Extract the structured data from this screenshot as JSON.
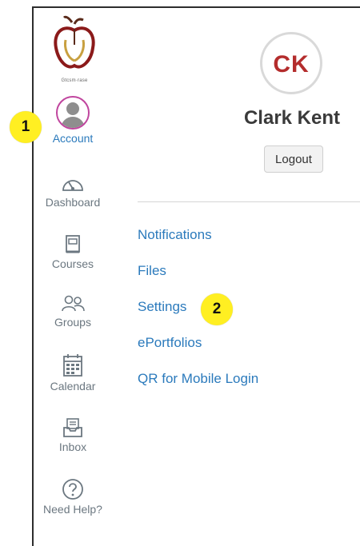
{
  "sidebar": {
    "logo_caption": "Gtcsm·rase",
    "items": [
      {
        "label": "Account",
        "icon": "user-avatar-icon"
      },
      {
        "label": "Dashboard",
        "icon": "speedometer-icon"
      },
      {
        "label": "Courses",
        "icon": "book-icon"
      },
      {
        "label": "Groups",
        "icon": "people-icon"
      },
      {
        "label": "Calendar",
        "icon": "calendar-icon"
      },
      {
        "label": "Inbox",
        "icon": "inbox-icon"
      },
      {
        "label": "Need Help?",
        "icon": "question-icon"
      }
    ]
  },
  "badges": {
    "one": "1",
    "two": "2"
  },
  "profile": {
    "initials": "CK",
    "name": "Clark Kent",
    "logout_label": "Logout"
  },
  "account_menu": [
    {
      "label": "Notifications"
    },
    {
      "label": "Files"
    },
    {
      "label": "Settings"
    },
    {
      "label": "ePortfolios"
    },
    {
      "label": "QR for Mobile Login"
    }
  ],
  "colors": {
    "link": "#2b7abc",
    "active_ring": "#c0459e",
    "badge": "#ffef22",
    "initials": "#b42d2d"
  }
}
